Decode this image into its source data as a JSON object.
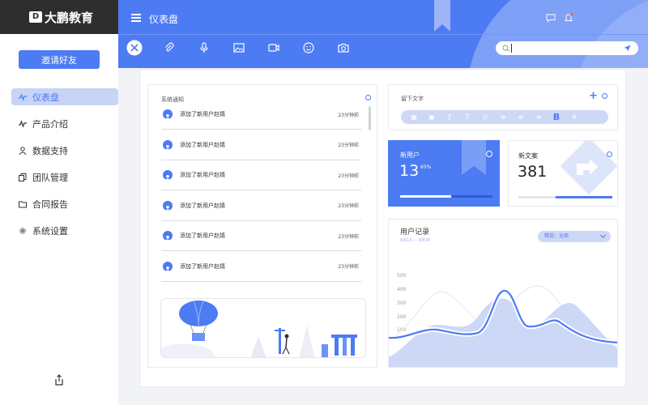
{
  "app": {
    "logo_text": "大鹏教育",
    "logo_mark": "D"
  },
  "sidebar": {
    "invite_label": "邀请好友",
    "items": [
      {
        "label": "仪表盘",
        "icon": "pulse-icon",
        "active": true
      },
      {
        "label": "产品介绍",
        "icon": "pulse-icon"
      },
      {
        "label": "数据支持",
        "icon": "user-icon"
      },
      {
        "label": "团队管理",
        "icon": "copy-icon"
      },
      {
        "label": "合同报告",
        "icon": "folder-icon"
      },
      {
        "label": "系统设置",
        "icon": "gear-icon"
      }
    ]
  },
  "header": {
    "title": "仪表盘"
  },
  "toolbar": {
    "icons": [
      "close-icon",
      "paperclip-icon",
      "microphone-icon",
      "image-icon",
      "video-icon",
      "smile-icon",
      "camera-icon"
    ]
  },
  "notices": {
    "title": "系统通知",
    "items": [
      {
        "text": "添加了新用户赵婧",
        "time": "23分钟前"
      },
      {
        "text": "添加了新用户赵婧",
        "time": "23分钟前"
      },
      {
        "text": "添加了新用户赵婧",
        "time": "23分钟前"
      },
      {
        "text": "添加了新用户赵婧",
        "time": "23分钟前"
      },
      {
        "text": "添加了新用户赵婧",
        "time": "23分钟前"
      },
      {
        "text": "添加了新用户赵婧",
        "time": "23分钟前"
      }
    ]
  },
  "message": {
    "title": "留下文字",
    "plus": "+",
    "bold_label": "B"
  },
  "new_users": {
    "title": "新用户",
    "value": "13",
    "percent": "65%",
    "progress": 0.55
  },
  "new_cases": {
    "title": "新文案",
    "value": "381",
    "progress": 0.6
  },
  "records": {
    "title": "用户记录",
    "date_range": "9月13 — 9月30",
    "filter": "精选：全部",
    "y_ticks": [
      "500",
      "400",
      "300",
      "200",
      "100"
    ]
  },
  "colors": {
    "accent": "#4c7bf3",
    "light": "#cdd8f7"
  }
}
